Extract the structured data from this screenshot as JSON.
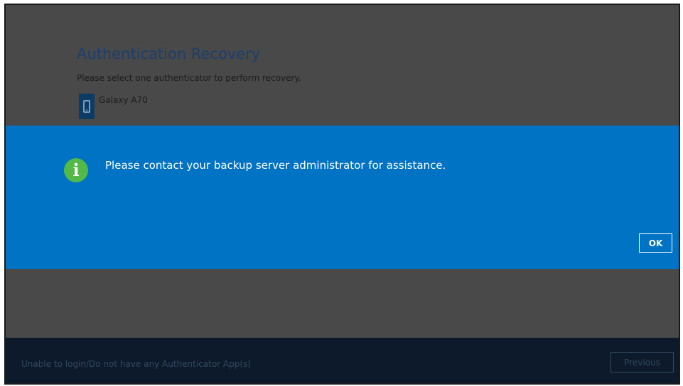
{
  "page": {
    "title": "Authentication Recovery",
    "subtitle": "Please select one authenticator to perform recovery."
  },
  "authenticators": [
    {
      "label": "Galaxy A70",
      "icon": "smartphone-icon"
    }
  ],
  "dialog": {
    "icon": "info-icon",
    "icon_glyph": "i",
    "message": "Please contact your backup server administrator for assistance.",
    "ok_label": "OK",
    "background_color": "#0073c4"
  },
  "footer": {
    "link_text": "Unable to login/Do not have any Authenticator App(s)",
    "previous_label": "Previous"
  }
}
